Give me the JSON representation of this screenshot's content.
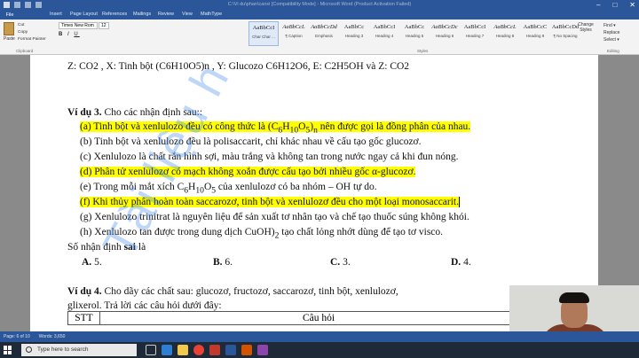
{
  "titlebar": {
    "title": "C:\\Vi du\\phan\\canxi [Compatibility Mode] - Microsoft Word (Product Activation Failed)"
  },
  "tabs": [
    "File",
    "Insert",
    "Page Layout",
    "References",
    "Mailings",
    "Review",
    "View",
    "MathType"
  ],
  "ribbon": {
    "paste": "Paste",
    "cut": "Cut",
    "copy": "Copy",
    "format_painter": "Format Painter",
    "clipboard_label": "Clipboard",
    "font_name": "Times New Rom",
    "font_size": "12",
    "styles": [
      {
        "sample": "AaBbCcI",
        "name": "Char Char ..."
      },
      {
        "sample": "AaBbCcL",
        "name": "¶ Caption"
      },
      {
        "sample": "AaBbCcDd",
        "name": "Emphasis"
      },
      {
        "sample": "AaBbCc",
        "name": "Heading 3"
      },
      {
        "sample": "AaBbCcI",
        "name": "Heading 4"
      },
      {
        "sample": "AaBbCc",
        "name": "Heading 5"
      },
      {
        "sample": "AaBbCcDc",
        "name": "Heading 6"
      },
      {
        "sample": "AaBbCcI",
        "name": "Heading 7"
      },
      {
        "sample": "AaBbCcL",
        "name": "Heading 8"
      },
      {
        "sample": "AaBbCcC",
        "name": "Heading 9"
      },
      {
        "sample": "AaBbCcDd",
        "name": "¶ No Spacing"
      }
    ],
    "change_styles": "Change Styles",
    "styles_label": "Styles",
    "editing": [
      "Find ▾",
      "Replace",
      "Select ▾"
    ],
    "editing_label": "Editing"
  },
  "document": {
    "line_top": "Z: CO2 , X: Tinh bột (C6H10O5)n , Y: Glucozo C6H12O6, E: C2H5OH và Z: CO2",
    "example_label": "Ví dụ 3.",
    "example_intro": " Cho các nhận định sau::",
    "statements": [
      {
        "pre": "(a) Tinh bột và xenlulozo đều có công thức là (C",
        "sub1": "6",
        "mid1": "H",
        "sub2": "10",
        "mid2": "O",
        "sub3": "5",
        "mid3": ")",
        "sub4": "n",
        "post": " nên được gọi là đồng phân của nhau."
      },
      {
        "text": "(b) Tinh bột và xenlulozo đều là polisaccarit, chỉ khác nhau về cấu tạo gốc glucozơ."
      },
      {
        "text": "(c) Xenlulozo là chất rắn hình sợi, màu trắng và không tan trong nước ngay cả khi đun nóng."
      },
      {
        "text": "(d) Phân tử xenlulozơ có mạch không xoắn được cấu tạo bởi nhiều gốc α-glucozơ."
      },
      {
        "pre": "(e) Trong mỗi mắt xích C",
        "sub1": "6",
        "mid1": "H",
        "sub2": "10",
        "mid2": "O",
        "sub3": "5",
        "post": " của xenlulozơ có ba nhóm – OH tự do."
      },
      {
        "text": "(f) Khi thủy phân hoàn toàn saccarozơ, tinh bột và xenlulozơ đều cho một loại monosaccarit."
      },
      {
        "text": "(g) Xenlulozo trinitrat là nguyên liệu để sản xuất tơ nhân tạo và chế tạo thuốc súng không khói."
      },
      {
        "pre": "(h) Xenlulozo tan được trong dung dịch CuOH)",
        "sub1": "2",
        "post": " tạo chất lỏng nhớt dùng để tạo tơ visco."
      }
    ],
    "question_pre": "Số nhận định ",
    "question_bold": "sai",
    "question_post": " là",
    "answers": [
      {
        "letter": "A.",
        "value": " 5."
      },
      {
        "letter": "B.",
        "value": " 6."
      },
      {
        "letter": "C.",
        "value": " 3."
      },
      {
        "letter": "D.",
        "value": " 4."
      }
    ],
    "example4_label": "Ví dụ 4.",
    "example4_line1": " Cho dãy các chất sau: glucozơ, fructozơ, saccarozơ, tinh bột, xenlulozơ,",
    "example4_line2": "glixerol. Trả lời các câu hỏi dưới đây:",
    "table_headers": [
      "STT",
      "Câu hỏi"
    ]
  },
  "watermark": "Tài liệu h",
  "statusbar": {
    "page": "Page: 6 of 10",
    "words": "Words: 3,650"
  },
  "taskbar": {
    "search_placeholder": "Type here to search"
  },
  "colors": {
    "word_blue": "#2b579a",
    "highlight": "#ffff00",
    "watermark": "#468ceb"
  }
}
